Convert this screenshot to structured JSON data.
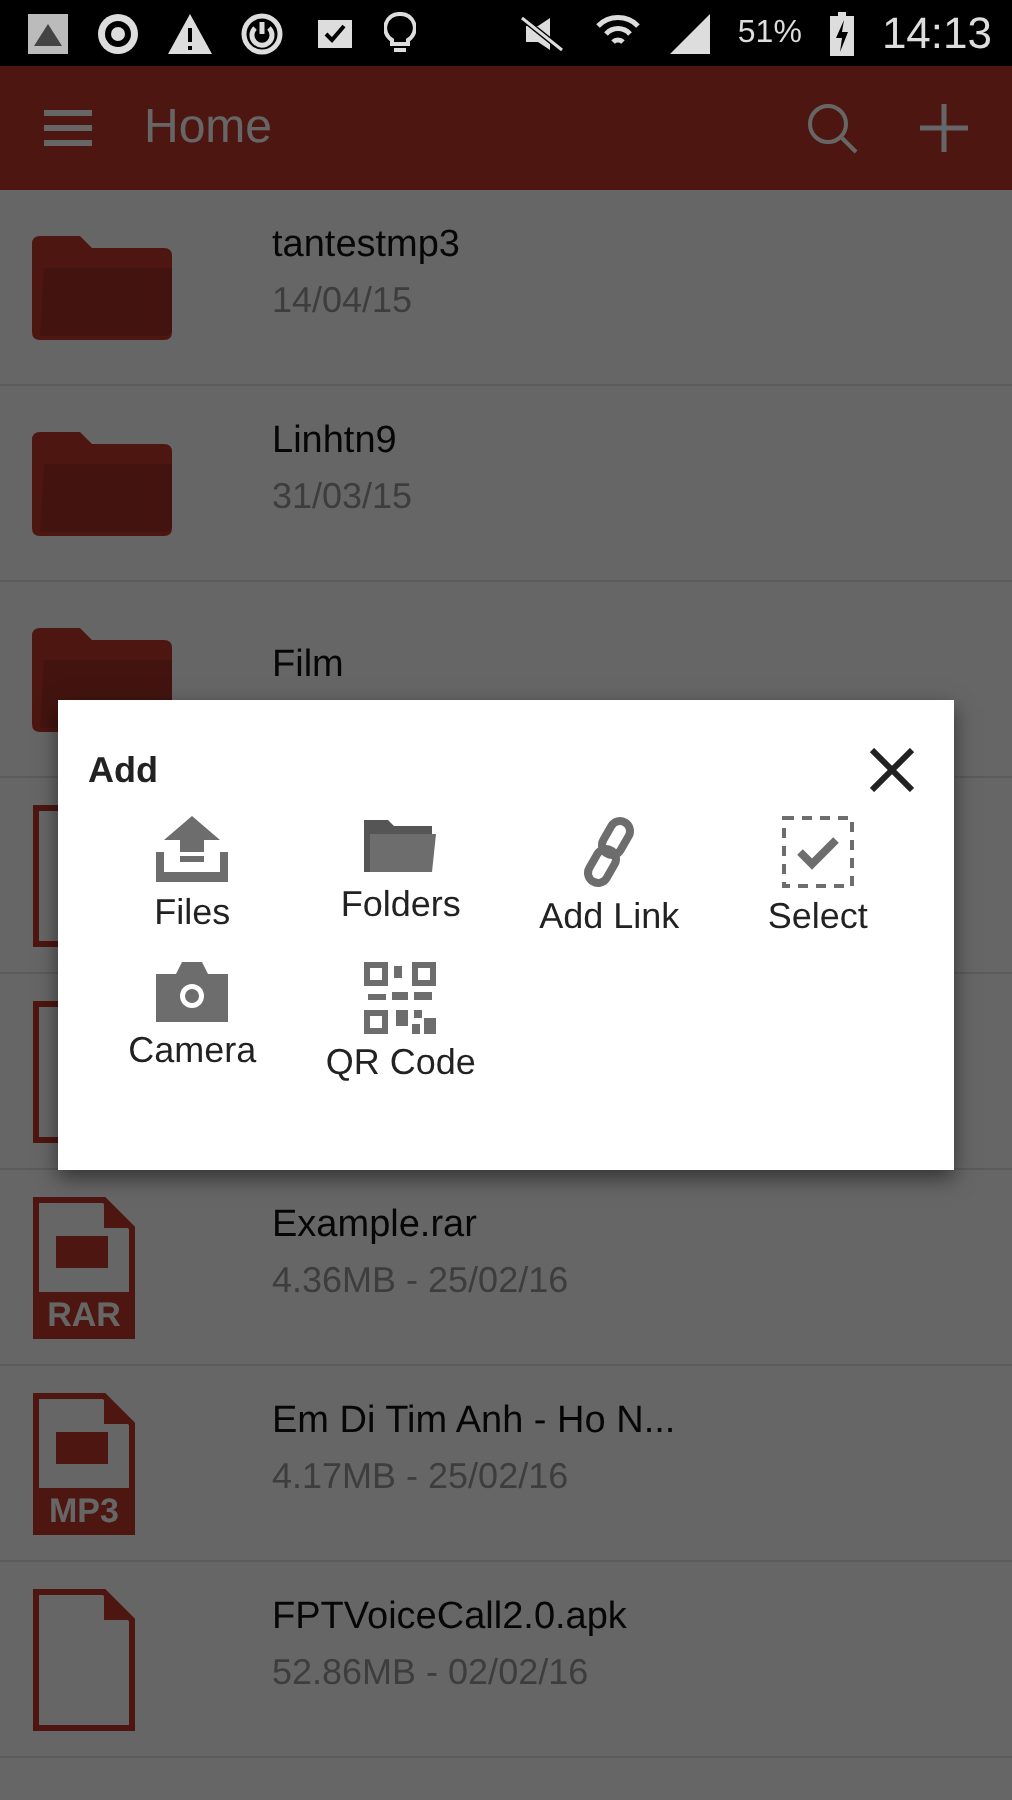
{
  "status_bar": {
    "battery": "51%",
    "time": "14:13"
  },
  "app_bar": {
    "title": "Home"
  },
  "items": [
    {
      "kind": "folder",
      "name": "tantestmp3",
      "meta": "14/04/15"
    },
    {
      "kind": "folder",
      "name": "Linhtn9",
      "meta": "31/03/15"
    },
    {
      "kind": "folder",
      "name": "Film"
    },
    {
      "kind": "file"
    },
    {
      "kind": "file"
    },
    {
      "kind": "badge",
      "badge": "RAR",
      "name": "Example.rar",
      "meta": "4.36MB - 25/02/16"
    },
    {
      "kind": "badge",
      "badge": "MP3",
      "name": "Em Di Tim Anh - Ho N...",
      "meta": "4.17MB - 25/02/16"
    },
    {
      "kind": "file",
      "name": "FPTVoiceCall2.0.apk",
      "meta": "52.86MB - 02/02/16"
    }
  ],
  "dialog": {
    "title": "Add",
    "options": [
      {
        "kind": "upload",
        "label": "Files"
      },
      {
        "kind": "folder",
        "label": "Folders"
      },
      {
        "kind": "link",
        "label": "Add Link"
      },
      {
        "kind": "select",
        "label": "Select"
      },
      {
        "kind": "camera",
        "label": "Camera"
      },
      {
        "kind": "qr",
        "label": "QR Code"
      }
    ]
  }
}
